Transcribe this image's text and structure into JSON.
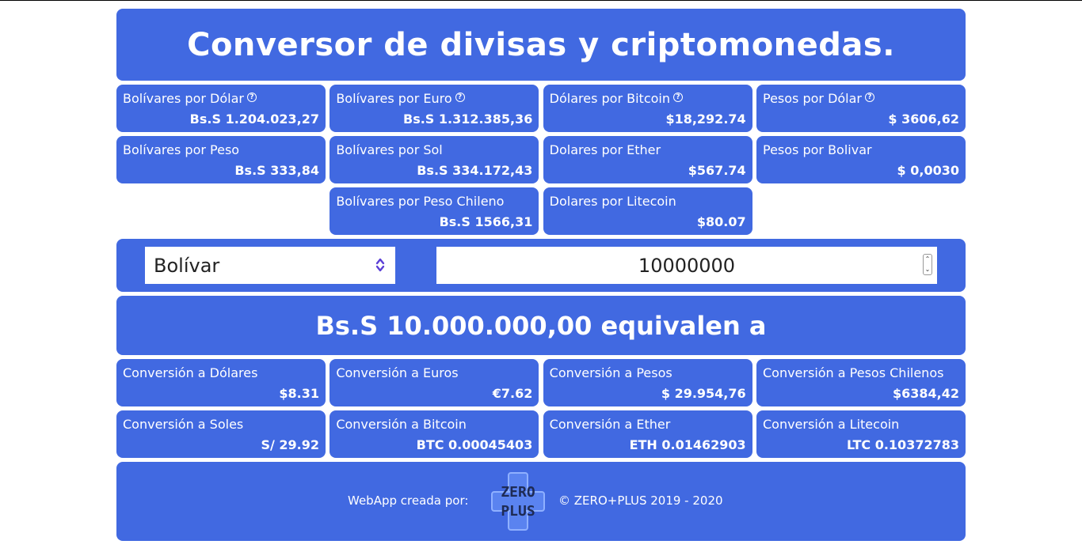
{
  "header": {
    "title": "Conversor de divisas y criptomonedas."
  },
  "rates": [
    {
      "label": "Bolívares por Dólar",
      "value": "Bs.S 1.204.023,27",
      "help": true
    },
    {
      "label": "Bolívares por Euro",
      "value": "Bs.S 1.312.385,36",
      "help": true
    },
    {
      "label": "Dólares por Bitcoin",
      "value": "$18,292.74",
      "help": true
    },
    {
      "label": "Pesos por Dólar",
      "value": "$ 3606,62",
      "help": true
    },
    {
      "label": "Bolívares por Peso",
      "value": "Bs.S 333,84"
    },
    {
      "label": "Bolívares por Sol",
      "value": "Bs.S 334.172,43"
    },
    {
      "label": "Dolares por Ether",
      "value": "$567.74"
    },
    {
      "label": "Pesos por Bolivar",
      "value": "$ 0,0030"
    },
    {
      "label": "Bolívares por Peso Chileno",
      "value": "Bs.S 1566,31"
    },
    {
      "label": "Dolares por Litecoin",
      "value": "$80.07"
    }
  ],
  "converter": {
    "currency_selected": "Bolívar",
    "amount_value": "10000000"
  },
  "result": {
    "headline": "Bs.S 10.000.000,00 equivalen a"
  },
  "conversions": [
    {
      "label": "Conversión a Dólares",
      "value": "$8.31"
    },
    {
      "label": "Conversión a Euros",
      "value": "€7.62"
    },
    {
      "label": "Conversión a Pesos",
      "value": "$ 29.954,76"
    },
    {
      "label": "Conversión a Pesos Chilenos",
      "value": "$6384,42"
    },
    {
      "label": "Conversión a Soles",
      "value": "S/ 29.92"
    },
    {
      "label": "Conversión a Bitcoin",
      "value": "BTC 0.00045403"
    },
    {
      "label": "Conversión a Ether",
      "value": "ETH 0.01462903"
    },
    {
      "label": "Conversión a Litecoin",
      "value": "LTC 0.10372783"
    }
  ],
  "footer": {
    "created_by": "WebApp creada por:",
    "logo_line1": "ZERO",
    "logo_line2": "PLUS",
    "copyright": "© ZERO+PLUS 2019 - 2020"
  },
  "colors": {
    "accent": "#4169e1",
    "select_arrow": "#5b3fd6"
  },
  "icons": {
    "help": "question-circle-icon",
    "select": "chevron-updown-icon"
  }
}
